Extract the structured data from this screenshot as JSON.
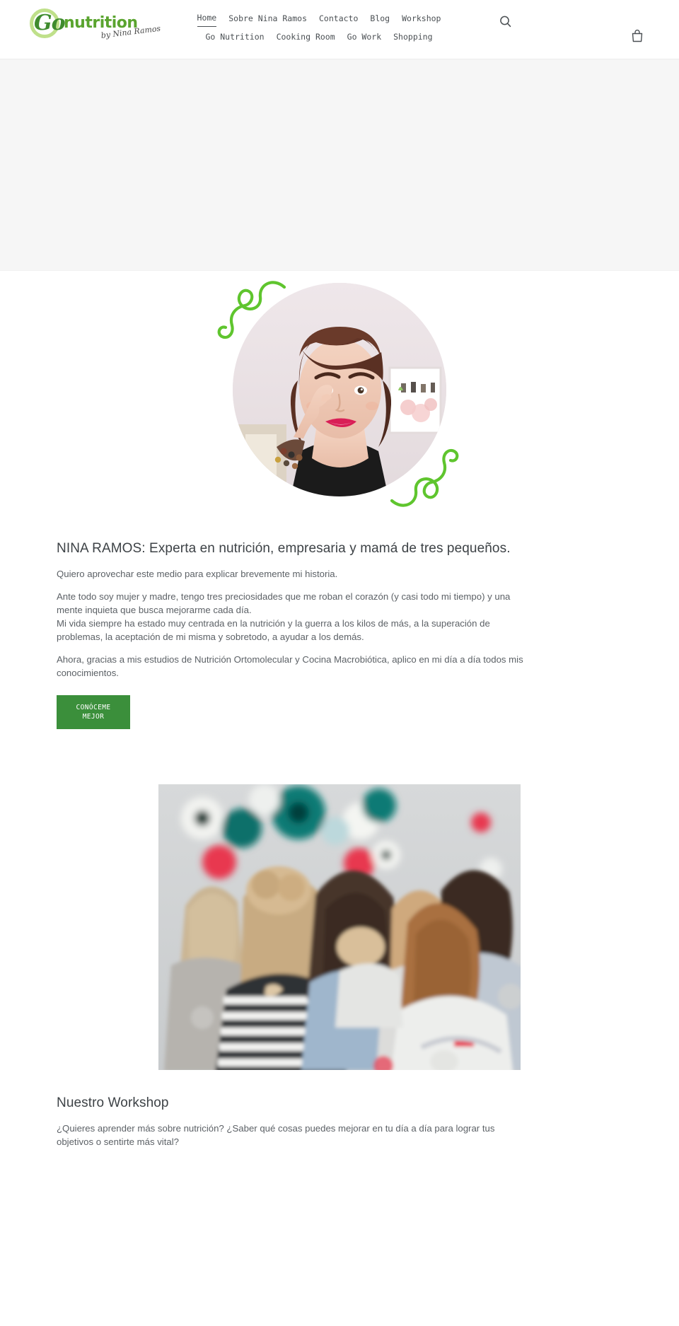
{
  "brand": {
    "logo_go": "Go",
    "logo_word": "nutrition",
    "logo_tagline": "by Nina Ramos",
    "accent_green": "#5aa42f",
    "dark_green": "#3f8b2e",
    "button_green": "#3b8f3b"
  },
  "header": {
    "nav_row_1": [
      {
        "label": "Home",
        "active": true
      },
      {
        "label": "Sobre Nina Ramos",
        "active": false
      },
      {
        "label": "Contacto",
        "active": false
      },
      {
        "label": "Blog",
        "active": false
      },
      {
        "label": "Workshop",
        "active": false
      }
    ],
    "nav_row_2": [
      {
        "label": "Go Nutrition",
        "active": false
      },
      {
        "label": "Cooking Room",
        "active": false
      },
      {
        "label": "Go Work",
        "active": false
      },
      {
        "label": "Shopping",
        "active": false
      }
    ],
    "search_icon": "search-icon",
    "cart_icon": "shopping-bag-icon"
  },
  "hero": {
    "placeholder": ""
  },
  "about": {
    "portrait_alt": "Nina Ramos portrait",
    "heading": "NINA RAMOS: Experta en nutrición, empresaria y mamá de tres pequeños.",
    "paragraph_1": "Quiero aprovechar este medio para explicar brevemente mi historia.",
    "paragraph_2": "Ante todo soy mujer y madre, tengo tres preciosidades que me roban el corazón (y casi todo mi tiempo) y una mente inquieta que busca mejorarme cada día.",
    "paragraph_3": "Mi vida siempre ha estado muy centrada en la nutrición y la guerra a los kilos de más, a la superación de problemas, la aceptación de mi misma y sobretodo, a ayudar a los demás.",
    "paragraph_4": "Ahora, gracias a mis estudios de Nutrición Ortomolecular y Cocina Macrobiótica, aplico en mi día a día todos mis conocimientos.",
    "cta_line_1": "CONÓCEME",
    "cta_line_2": "MEJOR"
  },
  "workshop": {
    "image_alt": "Asistentes de espaldas en un workshop",
    "heading": "Nuestro Workshop",
    "paragraph": "¿Quieres aprender más sobre nutrición? ¿Saber qué cosas puedes mejorar en tu día a día para lograr tus objetivos o sentirte más vital?"
  }
}
